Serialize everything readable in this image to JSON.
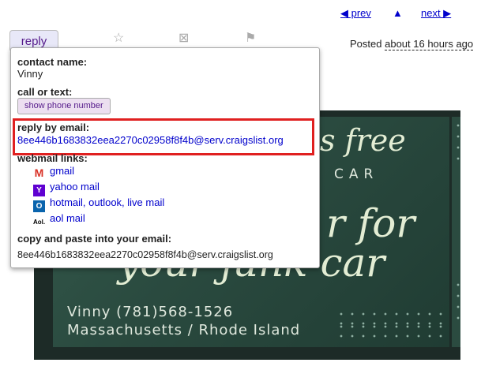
{
  "nav": {
    "prev_label": "◀ prev",
    "up_label": "▲",
    "next_label": "next ▶"
  },
  "posted": {
    "label": "Posted",
    "relative": "about 16 hours ago"
  },
  "toolbar": {
    "reply_label": "reply"
  },
  "ad": {
    "line1": "s free",
    "line2": "CAR",
    "line3": "r for",
    "line4": "your junk car",
    "contact": "Vinny (781)568-1526",
    "region": "Massachusetts / Rhode Island"
  },
  "popup": {
    "contact_label": "contact name:",
    "contact_name": "Vinny",
    "call_label": "call or text:",
    "phone_button": "show phone number",
    "email_label": "reply by email:",
    "email_address": "8ee446b1683832eea2270c02958f8f4b@serv.craigslist.org",
    "webmail_label": "webmail links:",
    "webmail": [
      {
        "label": "gmail",
        "icon": "gmail-icon",
        "color": "#d93025"
      },
      {
        "label": "yahoo mail",
        "icon": "yahoo-icon",
        "color": "#5f01d1"
      },
      {
        "label": "hotmail, outlook, live mail",
        "icon": "outlook-icon",
        "color": "#0a64ad"
      },
      {
        "label": "aol mail",
        "icon": "aol-icon",
        "color": "#000000"
      }
    ],
    "copy_label": "copy and paste into your email:",
    "copy_address": "8ee446b1683832eea2270c02958f8f4b@serv.craigslist.org"
  },
  "colors": {
    "highlight": "#e02020",
    "link": "#0000cc"
  }
}
